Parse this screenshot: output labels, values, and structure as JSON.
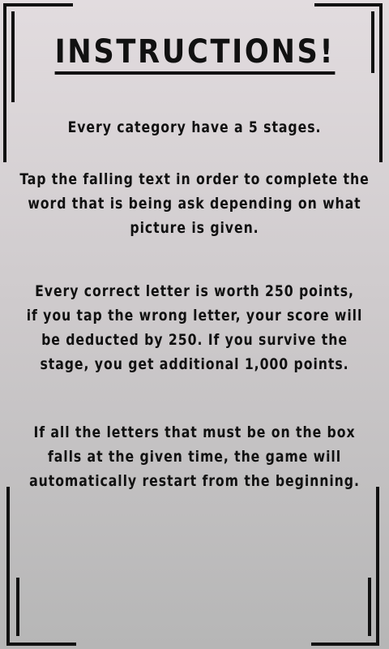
{
  "instructions": {
    "title": "INSTRUCTIONS!",
    "paragraphs": [
      [
        "Every category have a 5 stages."
      ],
      [
        "Tap the falling text in order to complete the",
        "word that is being ask depending on what",
        "picture is given."
      ],
      [
        "Every correct letter is worth 250 points,",
        "if you tap the wrong letter, your score will",
        "be deducted by 250.  If you survive the",
        "stage, you get additional 1,000 points."
      ],
      [
        "If all the letters that must be on the box",
        "falls at the given time, the game will",
        "automatically restart from the beginning."
      ]
    ]
  },
  "colors": {
    "text": "#111111",
    "frame": "#111111",
    "bg_top": "#e2dcdf",
    "bg_bottom": "#b6b6b6"
  }
}
